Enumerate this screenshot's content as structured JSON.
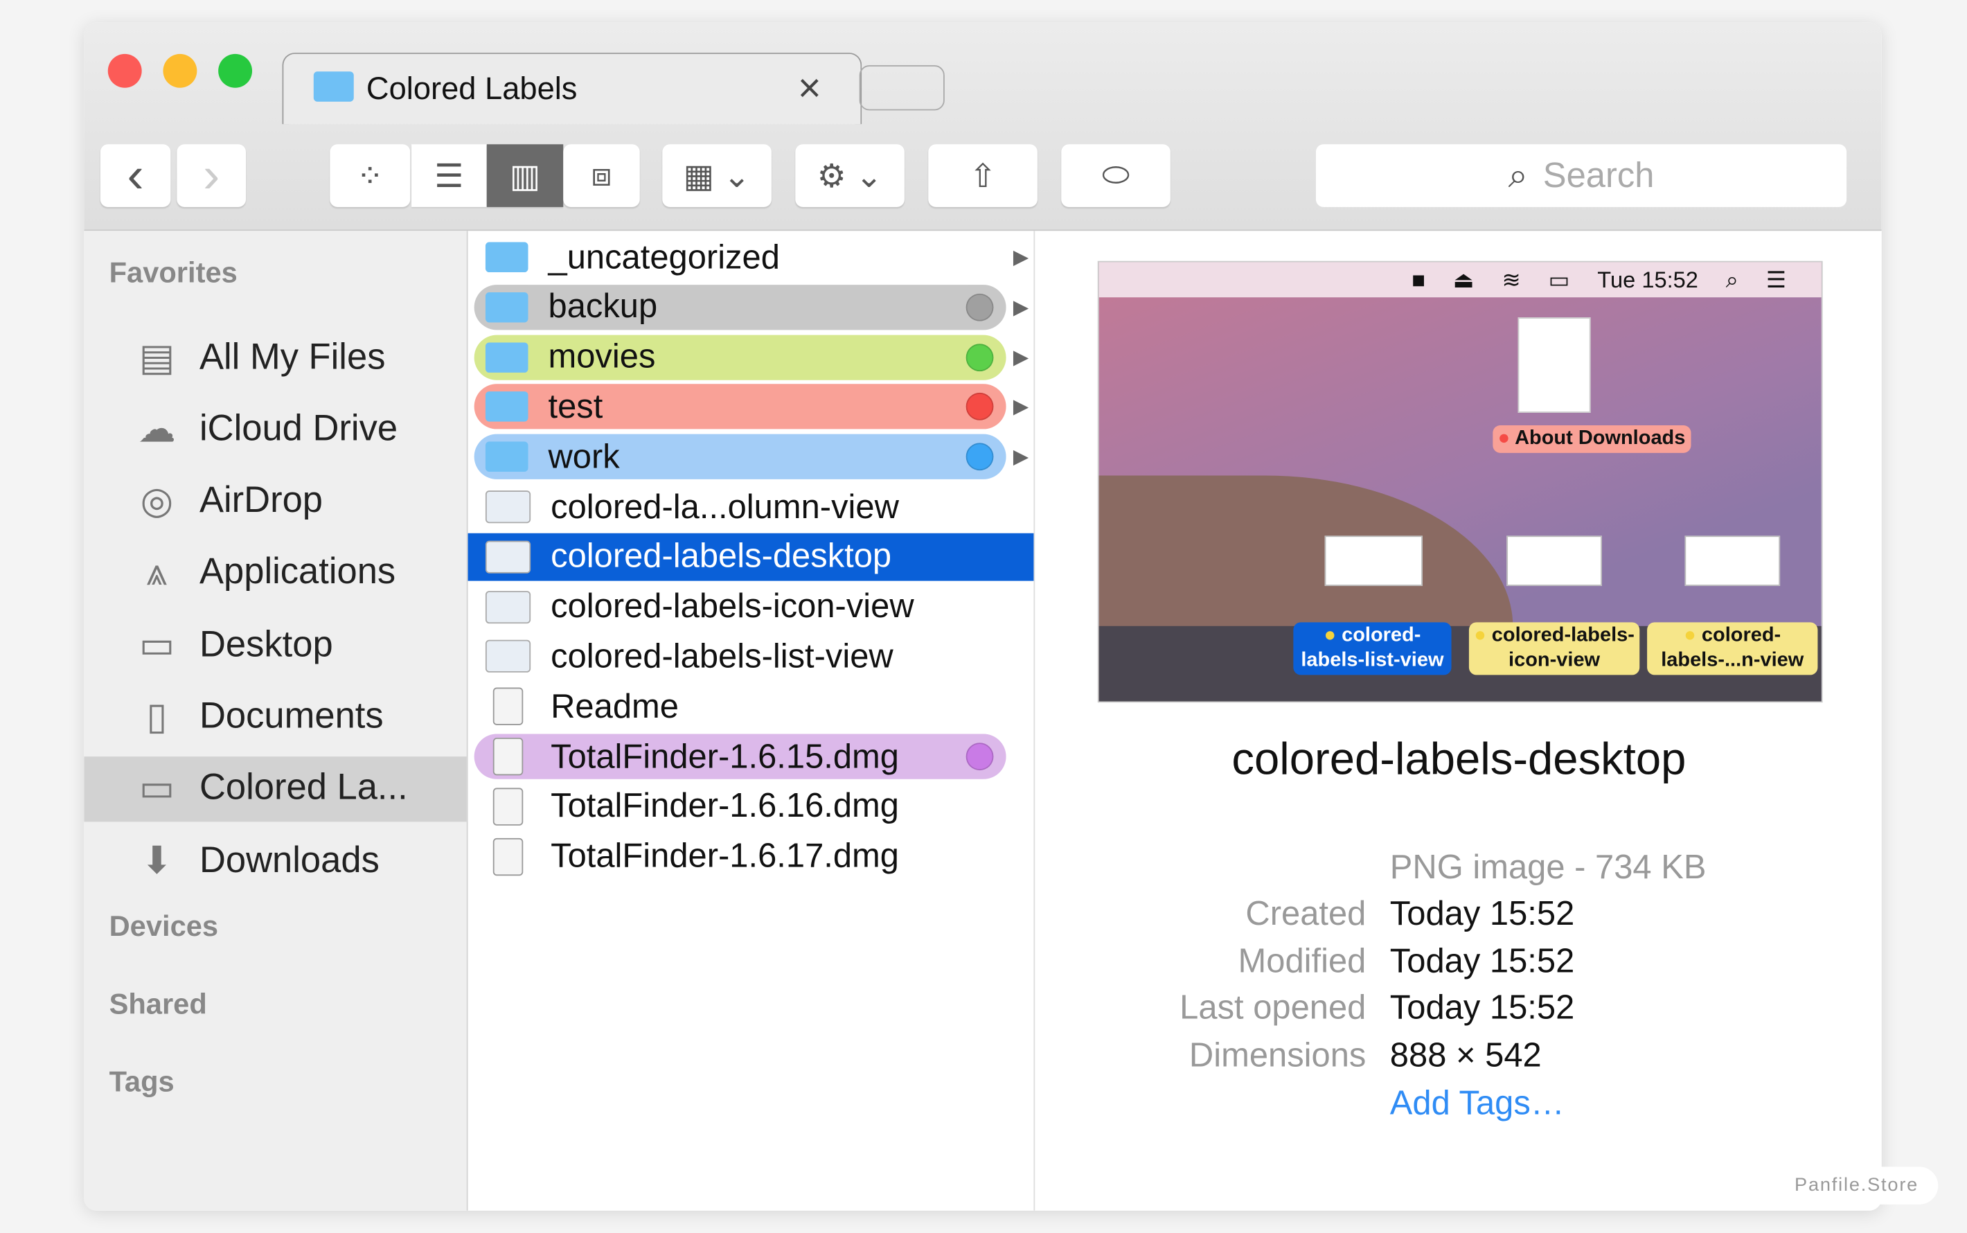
{
  "window": {
    "tab_title": "Colored Labels",
    "close_tab": "×"
  },
  "toolbar": {
    "back": "‹",
    "forward": "›",
    "search_placeholder": "Search"
  },
  "sidebar": {
    "favorites_header": "Favorites",
    "items": [
      {
        "label": "All My Files",
        "icon": "all-files-icon",
        "glyph": "▤"
      },
      {
        "label": "iCloud Drive",
        "icon": "cloud-icon",
        "glyph": "☁"
      },
      {
        "label": "AirDrop",
        "icon": "airdrop-icon",
        "glyph": "◎"
      },
      {
        "label": "Applications",
        "icon": "applications-icon",
        "glyph": "⩓"
      },
      {
        "label": "Desktop",
        "icon": "desktop-icon",
        "glyph": "▭"
      },
      {
        "label": "Documents",
        "icon": "documents-icon",
        "glyph": "▯"
      },
      {
        "label": "Colored La...",
        "icon": "folder-icon",
        "glyph": "▭",
        "selected": true
      },
      {
        "label": "Downloads",
        "icon": "downloads-icon",
        "glyph": "⬇"
      }
    ],
    "devices_header": "Devices",
    "shared_header": "Shared",
    "tags_header": "Tags"
  },
  "files": [
    {
      "name": "_uncategorized",
      "type": "folder",
      "arrow": true
    },
    {
      "name": "backup",
      "type": "folder",
      "label": "#c8c8c8",
      "dot": "#a0a0a0",
      "arrow": true
    },
    {
      "name": "movies",
      "type": "folder",
      "label": "#d6e88e",
      "dot": "#5cd04a",
      "arrow": true
    },
    {
      "name": "test",
      "type": "folder",
      "label": "#f9a197",
      "dot": "#f54b45",
      "arrow": true
    },
    {
      "name": "work",
      "type": "folder",
      "label": "#a3cdf7",
      "dot": "#3ba5f5",
      "arrow": true
    },
    {
      "name": "colored-la...olumn-view",
      "type": "image"
    },
    {
      "name": "colored-labels-desktop",
      "type": "image",
      "selected": true
    },
    {
      "name": "colored-labels-icon-view",
      "type": "image"
    },
    {
      "name": "colored-labels-list-view",
      "type": "image"
    },
    {
      "name": "Readme",
      "type": "doc"
    },
    {
      "name": "TotalFinder-1.6.15.dmg",
      "type": "dmg",
      "label": "#dcb9ea",
      "dot": "#c97be6"
    },
    {
      "name": "TotalFinder-1.6.16.dmg",
      "type": "dmg"
    },
    {
      "name": "TotalFinder-1.6.17.dmg",
      "type": "dmg"
    }
  ],
  "preview": {
    "menubar_time": "Tue 15:52",
    "desktop_items": [
      {
        "label": "About Downloads",
        "color": "#f9a197",
        "dot": "#f54b45"
      },
      {
        "label": "colored-labels-list-view",
        "color": "#0a60d8",
        "dot": "#f5d33c"
      },
      {
        "label": "colored-labels-icon-view",
        "color": "#f6e68a",
        "dot": "#f5d33c"
      },
      {
        "label": "colored-labels-...n-view",
        "color": "#f6e68a",
        "dot": "#f5d33c"
      }
    ],
    "filename": "colored-labels-desktop",
    "kind": "PNG image - 734 KB",
    "fields": [
      {
        "key": "Created",
        "value": "Today 15:52"
      },
      {
        "key": "Modified",
        "value": "Today 15:52"
      },
      {
        "key": "Last opened",
        "value": "Today 15:52"
      },
      {
        "key": "Dimensions",
        "value": "888 × 542"
      }
    ],
    "add_tags": "Add Tags…"
  },
  "watermark": "Panfile.Store"
}
